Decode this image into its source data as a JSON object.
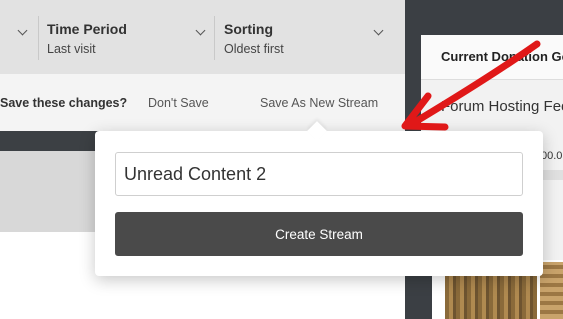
{
  "filters": {
    "time_period": {
      "title": "Time Period",
      "value": "Last visit"
    },
    "sorting": {
      "title": "Sorting",
      "value": "Oldest first"
    }
  },
  "save_bar": {
    "prompt": "Save these changes?",
    "dont_save": "Don't Save",
    "save_as_new": "Save As New Stream"
  },
  "popup": {
    "stream_name_value": "Unread Content 2",
    "create_button": "Create Stream"
  },
  "sidebar_widget": {
    "title": "Current Donation Goal",
    "goal_name": "Forum Hosting Fees",
    "amount_fragment": "00.0"
  },
  "colors": {
    "annotation_arrow": "#e01818",
    "create_button_bg": "#4a4a4a"
  },
  "icons": [
    "chevron-down-icon",
    "chevron-down-icon",
    "chevron-down-icon"
  ]
}
